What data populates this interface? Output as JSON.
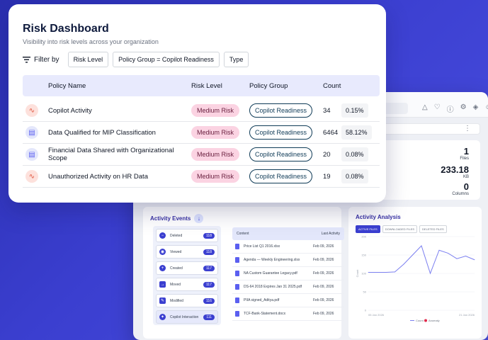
{
  "dashboard": {
    "title": "Risk Dashboard",
    "subtitle": "Visibility into risk levels across your organization",
    "filter_label": "Filter by",
    "filters": [
      "Risk Level",
      "Policy Group = Copilot Readiness",
      "Type"
    ],
    "columns": {
      "name": "Policy Name",
      "risk": "Risk Level",
      "group": "Policy Group",
      "count": "Count"
    },
    "rows": [
      {
        "icon": "activity-icon",
        "name": "Copilot Activity",
        "risk": "Medium Risk",
        "group": "Copilot Readiness",
        "count": "34",
        "pct": "0.15%"
      },
      {
        "icon": "document-icon",
        "name": "Data Qualified for MIP Classification",
        "risk": "Medium Risk",
        "group": "Copilot Readiness",
        "count": "6464",
        "pct": "58.12%"
      },
      {
        "icon": "document-icon",
        "name": "Financial Data Shared with Organizational Scope",
        "risk": "Medium Risk",
        "group": "Copilot Readiness",
        "count": "20",
        "pct": "0.08%"
      },
      {
        "icon": "activity-icon",
        "name": "Unauthorized Activity on HR Data",
        "risk": "Medium Risk",
        "group": "Copilot Readiness",
        "count": "19",
        "pct": "0.08%"
      }
    ]
  },
  "background": {
    "stats": [
      {
        "value": "1",
        "label": "Files"
      },
      {
        "value": "233.18",
        "label": "KB"
      },
      {
        "value": "0",
        "label": "Columns"
      }
    ],
    "activity_events": {
      "title": "Activity Events",
      "events": [
        {
          "label": "Deleted",
          "count": "118"
        },
        {
          "label": "Viewed",
          "count": "118"
        },
        {
          "label": "Created",
          "count": "117"
        },
        {
          "label": "Moved",
          "count": "117"
        },
        {
          "label": "Modified",
          "count": "116"
        },
        {
          "label": "Copilot Interaction",
          "count": "111"
        }
      ],
      "table_head": {
        "content": "Content",
        "last": "Last Activity"
      },
      "files": [
        {
          "name": "Price List Q1 2016.xlsx",
          "date": "Feb 09, 2026"
        },
        {
          "name": "Agenda — Weekly Engineering.xlsx",
          "date": "Feb 09, 2026"
        },
        {
          "name": "NA Custom Guarantee Legacy.pdf",
          "date": "Feb 09, 2026"
        },
        {
          "name": "DS-64 2018 Expires Jan 31 2025.pdf",
          "date": "Feb 09, 2026"
        },
        {
          "name": "PIIA signed_Aditya.pdf",
          "date": "Feb 09, 2026"
        },
        {
          "name": "TCF-Bank-Statement.docx",
          "date": "Feb 09, 2026"
        }
      ]
    },
    "activity_analysis": {
      "title": "Activity Analysis",
      "tabs": [
        "ACTIVE FILES",
        "DOWNLOADED FILES",
        "DELETED FILES"
      ]
    }
  },
  "chart_data": {
    "type": "line",
    "ylabel": "Count",
    "ylim": [
      0,
      200
    ],
    "y_ticks": [
      "200",
      "150",
      "100",
      "50",
      "0"
    ],
    "x_tick_labels": [
      "05 Jan 2026",
      "21 Jan 2026"
    ],
    "series": [
      {
        "name": "Count",
        "values": [
          103,
          103,
          103,
          104,
          125,
          150,
          175,
          100,
          163,
          155,
          140,
          147,
          137
        ]
      }
    ],
    "legend": [
      "Count",
      "Anomaly"
    ],
    "colors": {
      "line": "#7b7ff0",
      "anomaly": "#e0294a"
    }
  }
}
